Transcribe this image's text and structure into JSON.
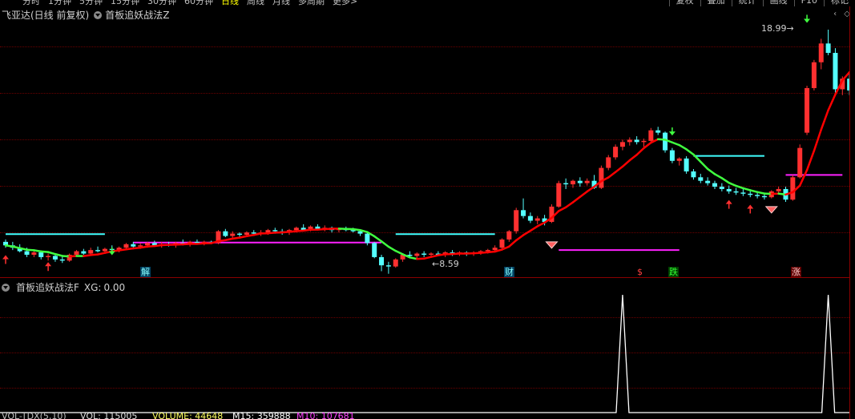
{
  "topbar": {
    "periods": [
      "分时",
      "1分钟",
      "5分钟",
      "15分钟",
      "30分钟",
      "60分钟",
      "日线",
      "周线",
      "月线",
      "多周期",
      "更多>"
    ],
    "active_period": "日线",
    "tools": [
      "复权",
      "叠加",
      "统计",
      "画线",
      "F10",
      "标记"
    ]
  },
  "main_panel": {
    "stock_title": "飞亚达(日线 前复权)",
    "indicator_title": "首板追妖战法Z",
    "high_label": "18.99",
    "low_label": "8.59",
    "markers": {
      "jie": "解",
      "cai": "财",
      "dollar": "$",
      "die": "跌",
      "zhang": "涨"
    }
  },
  "sub_panel": {
    "indicator_title": "首板追妖战法F",
    "xg_label": "XG:",
    "xg_value": "0.00"
  },
  "bottom_strip": {
    "vol_label": "VOL-TDX(5,10)",
    "vol_value": "VOL: 115005",
    "vol_ma5": "VOLUME: 44648",
    "vol_ma10": "M15: 359888",
    "vol_ma20": "M10: 107681"
  },
  "colors": {
    "up": "#ff3030",
    "down": "#54ffff",
    "ma_red": "#ff0000",
    "ma_green": "#40ff40",
    "line_cyan": "#40ffff",
    "line_magenta": "#ff20ff",
    "grid": "#6a0000"
  },
  "chart_data": {
    "type": "candlestick",
    "scale_note": "approximate daily candles; price read from labels 8.59 (low) and 18.99 (high)",
    "candles": [
      [
        9.95,
        10.05,
        9.7,
        9.8
      ],
      [
        9.8,
        9.95,
        9.6,
        9.7
      ],
      [
        9.7,
        9.85,
        9.5,
        9.55
      ],
      [
        9.55,
        9.7,
        9.3,
        9.4
      ],
      [
        9.4,
        9.6,
        9.3,
        9.5
      ],
      [
        9.5,
        9.55,
        9.2,
        9.3
      ],
      [
        9.3,
        9.45,
        9.15,
        9.35
      ],
      [
        9.35,
        9.4,
        9.1,
        9.2
      ],
      [
        9.2,
        9.35,
        9.05,
        9.15
      ],
      [
        9.15,
        9.45,
        9.1,
        9.4
      ],
      [
        9.4,
        9.6,
        9.35,
        9.55
      ],
      [
        9.55,
        9.65,
        9.4,
        9.45
      ],
      [
        9.45,
        9.7,
        9.4,
        9.6
      ],
      [
        9.6,
        9.75,
        9.5,
        9.55
      ],
      [
        9.55,
        9.7,
        9.45,
        9.65
      ],
      [
        9.65,
        9.8,
        9.55,
        9.6
      ],
      [
        9.6,
        9.75,
        9.5,
        9.7
      ],
      [
        9.7,
        9.9,
        9.6,
        9.85
      ],
      [
        9.85,
        9.95,
        9.7,
        9.75
      ],
      [
        9.75,
        9.9,
        9.65,
        9.8
      ],
      [
        9.8,
        9.95,
        9.7,
        9.9
      ],
      [
        9.9,
        10.0,
        9.75,
        9.8
      ],
      [
        9.8,
        9.95,
        9.7,
        9.85
      ],
      [
        9.85,
        9.95,
        9.75,
        9.8
      ],
      [
        9.8,
        9.95,
        9.7,
        9.9
      ],
      [
        9.9,
        10.05,
        9.8,
        9.85
      ],
      [
        9.85,
        10.0,
        9.75,
        9.95
      ],
      [
        9.95,
        10.05,
        9.85,
        9.9
      ],
      [
        9.9,
        10.0,
        9.8,
        9.95
      ],
      [
        9.95,
        10.0,
        9.85,
        9.9
      ],
      [
        9.9,
        10.45,
        9.85,
        10.4
      ],
      [
        10.4,
        10.5,
        10.15,
        10.2
      ],
      [
        10.2,
        10.4,
        10.1,
        10.3
      ],
      [
        10.3,
        10.35,
        10.15,
        10.25
      ],
      [
        10.25,
        10.4,
        10.15,
        10.35
      ],
      [
        10.35,
        10.45,
        10.2,
        10.3
      ],
      [
        10.3,
        10.45,
        10.2,
        10.35
      ],
      [
        10.35,
        10.5,
        10.25,
        10.45
      ],
      [
        10.45,
        10.55,
        10.3,
        10.4
      ],
      [
        10.4,
        10.5,
        10.25,
        10.35
      ],
      [
        10.35,
        10.5,
        10.25,
        10.45
      ],
      [
        10.45,
        10.6,
        10.35,
        10.55
      ],
      [
        10.55,
        10.7,
        10.4,
        10.45
      ],
      [
        10.45,
        10.65,
        10.4,
        10.6
      ],
      [
        10.6,
        10.7,
        10.45,
        10.5
      ],
      [
        10.5,
        10.65,
        10.4,
        10.55
      ],
      [
        10.55,
        10.6,
        10.35,
        10.45
      ],
      [
        10.45,
        10.55,
        10.35,
        10.5
      ],
      [
        10.5,
        10.6,
        10.4,
        10.45
      ],
      [
        10.45,
        10.55,
        10.35,
        10.4
      ],
      [
        10.4,
        10.45,
        10.2,
        10.3
      ],
      [
        10.3,
        10.35,
        9.8,
        9.9
      ],
      [
        9.9,
        9.95,
        9.25,
        9.3
      ],
      [
        9.3,
        9.4,
        8.7,
        8.95
      ],
      [
        8.95,
        9.1,
        8.59,
        8.9
      ],
      [
        8.9,
        9.25,
        8.85,
        9.2
      ],
      [
        9.2,
        9.45,
        9.1,
        9.4
      ],
      [
        9.4,
        9.55,
        9.25,
        9.35
      ],
      [
        9.35,
        9.5,
        9.25,
        9.45
      ],
      [
        9.45,
        9.55,
        9.3,
        9.4
      ],
      [
        9.4,
        9.5,
        9.3,
        9.45
      ],
      [
        9.45,
        9.55,
        9.35,
        9.4
      ],
      [
        9.4,
        9.55,
        9.3,
        9.5
      ],
      [
        9.5,
        9.6,
        9.35,
        9.45
      ],
      [
        9.45,
        9.55,
        9.35,
        9.5
      ],
      [
        9.5,
        9.55,
        9.35,
        9.45
      ],
      [
        9.45,
        9.55,
        9.35,
        9.5
      ],
      [
        9.5,
        9.6,
        9.4,
        9.55
      ],
      [
        9.55,
        9.65,
        9.45,
        9.6
      ],
      [
        9.6,
        9.8,
        9.55,
        9.7
      ],
      [
        9.7,
        10.1,
        9.65,
        10.05
      ],
      [
        10.05,
        10.45,
        9.95,
        10.4
      ],
      [
        10.4,
        11.4,
        10.3,
        11.3
      ],
      [
        11.3,
        11.8,
        10.95,
        11.05
      ],
      [
        11.05,
        11.2,
        10.75,
        10.85
      ],
      [
        10.85,
        11.05,
        10.7,
        10.95
      ],
      [
        10.95,
        11.1,
        10.65,
        10.8
      ],
      [
        10.8,
        11.55,
        10.75,
        11.45
      ],
      [
        11.45,
        12.55,
        11.4,
        12.45
      ],
      [
        12.45,
        12.65,
        12.2,
        12.4
      ],
      [
        12.4,
        12.6,
        12.25,
        12.55
      ],
      [
        12.55,
        12.7,
        12.3,
        12.45
      ],
      [
        12.45,
        12.65,
        12.35,
        12.55
      ],
      [
        12.55,
        12.8,
        12.2,
        12.25
      ],
      [
        12.25,
        13.2,
        12.2,
        13.1
      ],
      [
        13.1,
        13.65,
        13.0,
        13.55
      ],
      [
        13.55,
        14.1,
        13.45,
        14.0
      ],
      [
        14.0,
        14.3,
        13.85,
        14.2
      ],
      [
        14.2,
        14.4,
        14.05,
        14.3
      ],
      [
        14.3,
        14.45,
        14.1,
        14.2
      ],
      [
        14.2,
        14.35,
        14.0,
        14.25
      ],
      [
        14.25,
        14.8,
        14.2,
        14.7
      ],
      [
        14.7,
        14.85,
        14.5,
        14.6
      ],
      [
        14.6,
        14.65,
        13.75,
        13.85
      ],
      [
        13.85,
        13.95,
        13.3,
        13.4
      ],
      [
        13.4,
        13.55,
        13.2,
        13.5
      ],
      [
        13.5,
        13.6,
        12.85,
        12.95
      ],
      [
        12.95,
        13.05,
        12.6,
        12.7
      ],
      [
        12.7,
        12.85,
        12.45,
        12.55
      ],
      [
        12.55,
        12.7,
        12.35,
        12.45
      ],
      [
        12.45,
        12.55,
        12.2,
        12.3
      ],
      [
        12.3,
        12.45,
        12.1,
        12.2
      ],
      [
        12.2,
        12.35,
        12.0,
        12.1
      ],
      [
        12.1,
        12.25,
        11.95,
        12.05
      ],
      [
        12.05,
        12.2,
        11.9,
        12.0
      ],
      [
        12.0,
        12.15,
        11.85,
        11.95
      ],
      [
        11.95,
        12.1,
        11.8,
        11.9
      ],
      [
        11.9,
        12.0,
        11.75,
        11.85
      ],
      [
        11.85,
        12.15,
        11.8,
        12.1
      ],
      [
        12.1,
        12.3,
        12.0,
        12.2
      ],
      [
        12.2,
        12.3,
        11.65,
        11.75
      ],
      [
        11.75,
        12.8,
        11.7,
        12.7
      ],
      [
        12.7,
        14.1,
        12.65,
        13.95
      ],
      [
        14.6,
        16.6,
        14.5,
        16.5
      ],
      [
        16.5,
        17.7,
        16.4,
        17.6
      ],
      [
        17.6,
        18.6,
        17.3,
        18.4
      ],
      [
        18.4,
        18.99,
        17.9,
        18.0
      ],
      [
        18.0,
        18.2,
        16.3,
        16.45
      ],
      [
        16.45,
        17.0,
        16.2,
        16.9
      ],
      [
        16.9,
        17.2,
        16.2,
        16.4
      ],
      [
        16.4,
        17.15,
        16.3,
        16.95
      ],
      [
        16.95,
        17.1,
        16.35,
        16.45
      ],
      [
        16.45,
        16.6,
        15.9,
        16.05
      ],
      [
        16.05,
        16.2,
        15.9,
        16.15
      ]
    ],
    "ma_line": {
      "name": "",
      "segments": "red when rising, green when falling"
    },
    "sub_panel_xg_spikes": [
      87,
      116
    ]
  }
}
